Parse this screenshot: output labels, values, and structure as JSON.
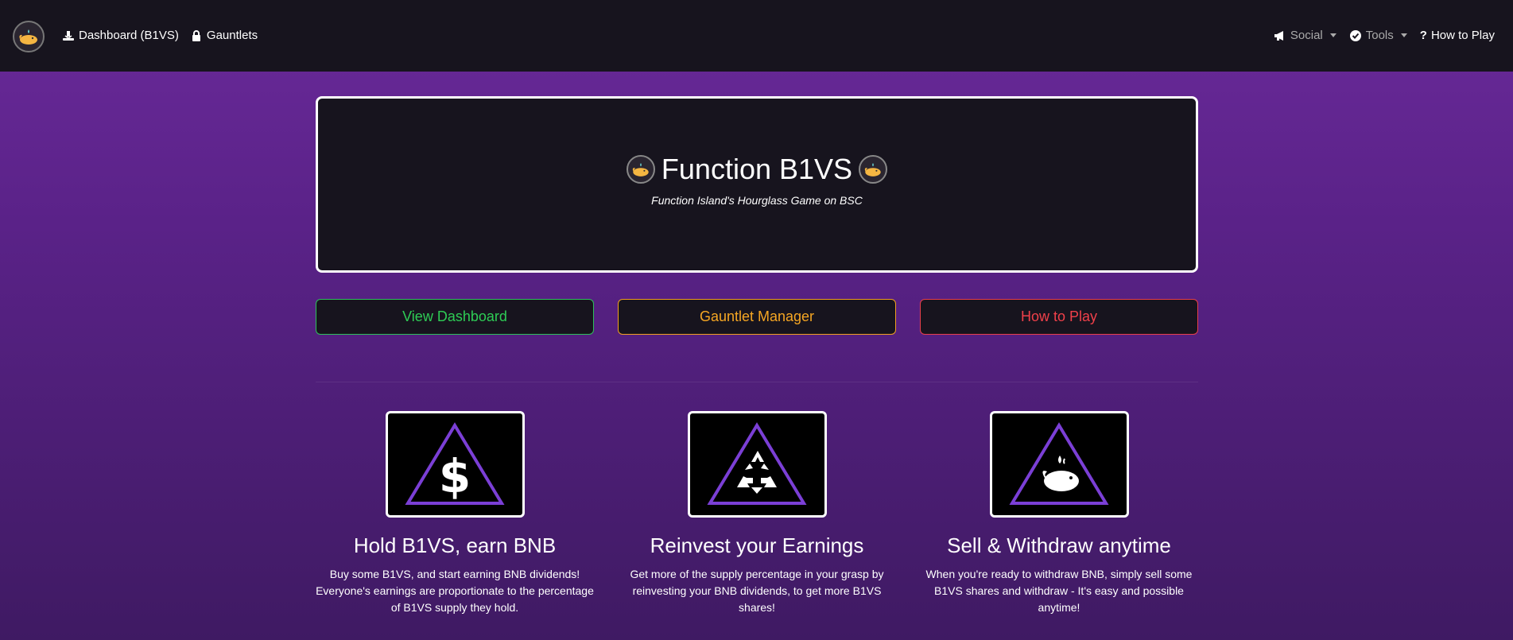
{
  "nav": {
    "dashboard_label": "Dashboard (B1VS)",
    "gauntlets_label": "Gauntlets",
    "social_label": "Social",
    "tools_label": "Tools",
    "howto_label": "How to Play"
  },
  "hero": {
    "title": "Function B1VS",
    "subtitle": "Function Island's Hourglass Game on BSC"
  },
  "buttons": {
    "dashboard": "View Dashboard",
    "gauntlet": "Gauntlet Manager",
    "howto": "How to Play"
  },
  "features": [
    {
      "icon": "dollar-icon",
      "title": "Hold B1VS, earn BNB",
      "text": "Buy some B1VS, and start earning BNB dividends! Everyone's earnings are proportionate to the percentage of B1VS supply they hold."
    },
    {
      "icon": "recycle-icon",
      "title": "Reinvest your Earnings",
      "text": "Get more of the supply percentage in your grasp by reinvesting your BNB dividends, to get more B1VS shares!"
    },
    {
      "icon": "whale-icon",
      "title": "Sell & Withdraw anytime",
      "text": "When you're ready to withdraw BNB, simply sell some B1VS shares and withdraw - It's easy and possible anytime!"
    }
  ],
  "colors": {
    "accent_purple": "#7b3fd6",
    "green": "#2ecc55",
    "orange": "#f5a623",
    "red": "#f0404a"
  }
}
